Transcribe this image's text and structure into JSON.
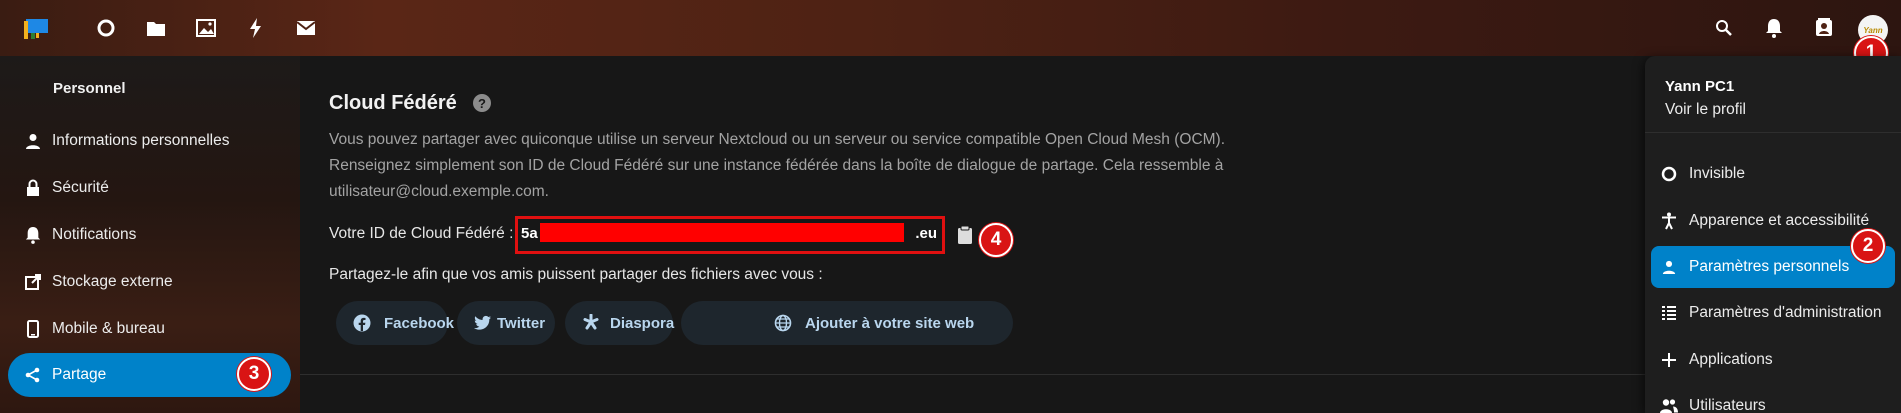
{
  "header": {
    "logo_icon": "nextcloud-folder-logo-icon",
    "apps": [
      {
        "icon": "status-circle-icon"
      },
      {
        "icon": "folder-icon"
      },
      {
        "icon": "image-icon"
      },
      {
        "icon": "activity-bolt-icon"
      },
      {
        "icon": "mail-icon"
      }
    ],
    "right_icons": [
      "search-icon",
      "bell-icon",
      "contacts-icon"
    ],
    "avatar_text": "Yann",
    "badge_1": "1"
  },
  "nav": {
    "heading": "Personnel",
    "items": [
      {
        "label": "Informations personnelles",
        "icon": "person-icon"
      },
      {
        "label": "Sécurité",
        "icon": "lock-icon"
      },
      {
        "label": "Notifications",
        "icon": "bell-icon"
      },
      {
        "label": "Stockage externe",
        "icon": "external-link-icon"
      },
      {
        "label": "Mobile & bureau",
        "icon": "phone-icon"
      },
      {
        "label": "Partage",
        "icon": "share-icon",
        "active": true
      }
    ],
    "badge_3": "3"
  },
  "main": {
    "title": "Cloud Fédéré",
    "description": "Vous pouvez partager avec quiconque utilise un serveur Nextcloud ou un serveur ou service compatible Open Cloud Mesh (OCM). Renseignez simplement son ID de Cloud Fédéré sur une instance fédérée dans la boîte de dialogue de partage. Cela ressemble à utilisateur@cloud.exemple.com.",
    "id_label": "Votre ID de Cloud Fédéré :",
    "id_prefix": "5a",
    "id_suffix": ".eu",
    "badge_4": "4",
    "share_text": "Partagez-le afin que vos amis puissent partager des fichiers avec vous :",
    "share_buttons": [
      {
        "label": "Facebook",
        "icon": "facebook-icon"
      },
      {
        "label": "Twitter",
        "icon": "twitter-icon"
      },
      {
        "label": "Diaspora",
        "icon": "diaspora-icon"
      },
      {
        "label": "Ajouter à votre site web",
        "icon": "globe-icon"
      }
    ]
  },
  "user_menu": {
    "name": "Yann PC1",
    "profile_link": "Voir le profil",
    "items": [
      {
        "label": "Invisible",
        "icon": "status-circle-icon"
      },
      {
        "label": "Apparence et accessibilité",
        "icon": "accessibility-icon"
      },
      {
        "label": "Paramètres personnels",
        "icon": "person-icon",
        "active": true
      },
      {
        "label": "Paramètres d'administration",
        "icon": "admin-list-icon"
      },
      {
        "label": "Applications",
        "icon": "plus-icon"
      },
      {
        "label": "Utilisateurs",
        "icon": "users-icon"
      }
    ],
    "badge_2": "2"
  },
  "colors": {
    "accent": "#0082c9",
    "annotation_red": "#d91414",
    "redaction": "#ff0000"
  }
}
